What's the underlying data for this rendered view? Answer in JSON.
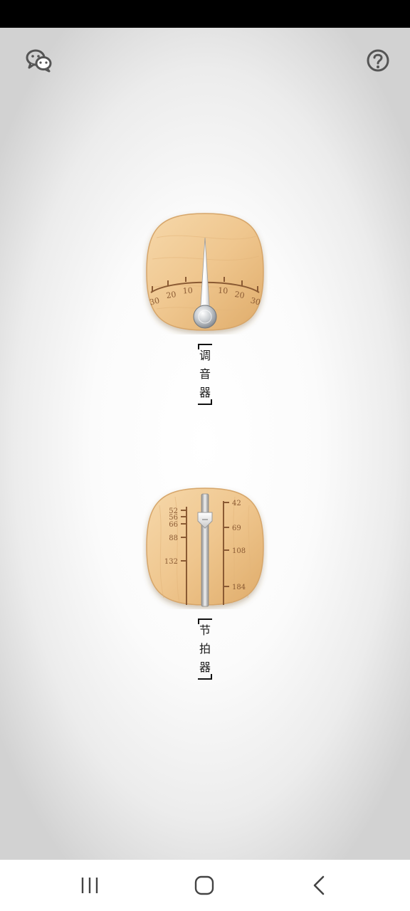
{
  "app": {
    "tools": [
      {
        "id": "tuner",
        "label_chars": [
          "调",
          "音",
          "器"
        ],
        "icon": "tuner-dial-icon",
        "scale_left": [
          "30",
          "20",
          "10"
        ],
        "scale_right": [
          "10",
          "20",
          "30"
        ]
      },
      {
        "id": "metronome",
        "label_chars": [
          "节",
          "拍",
          "器"
        ],
        "icon": "metronome-slider-icon",
        "scale_left": [
          "52",
          "56",
          "66",
          "88",
          "132"
        ],
        "scale_right": [
          "42",
          "69",
          "108",
          "184"
        ]
      }
    ],
    "top_icons": {
      "left": "wechat-icon",
      "right": "help-icon"
    }
  },
  "navigation": {
    "recent": "recent-apps-icon",
    "home": "home-icon",
    "back": "back-icon"
  },
  "colors": {
    "wood_light": "#f2cf9c",
    "wood_dark": "#d9a461",
    "scale_ink": "#8a5a33",
    "icon_gray": "#555555"
  }
}
